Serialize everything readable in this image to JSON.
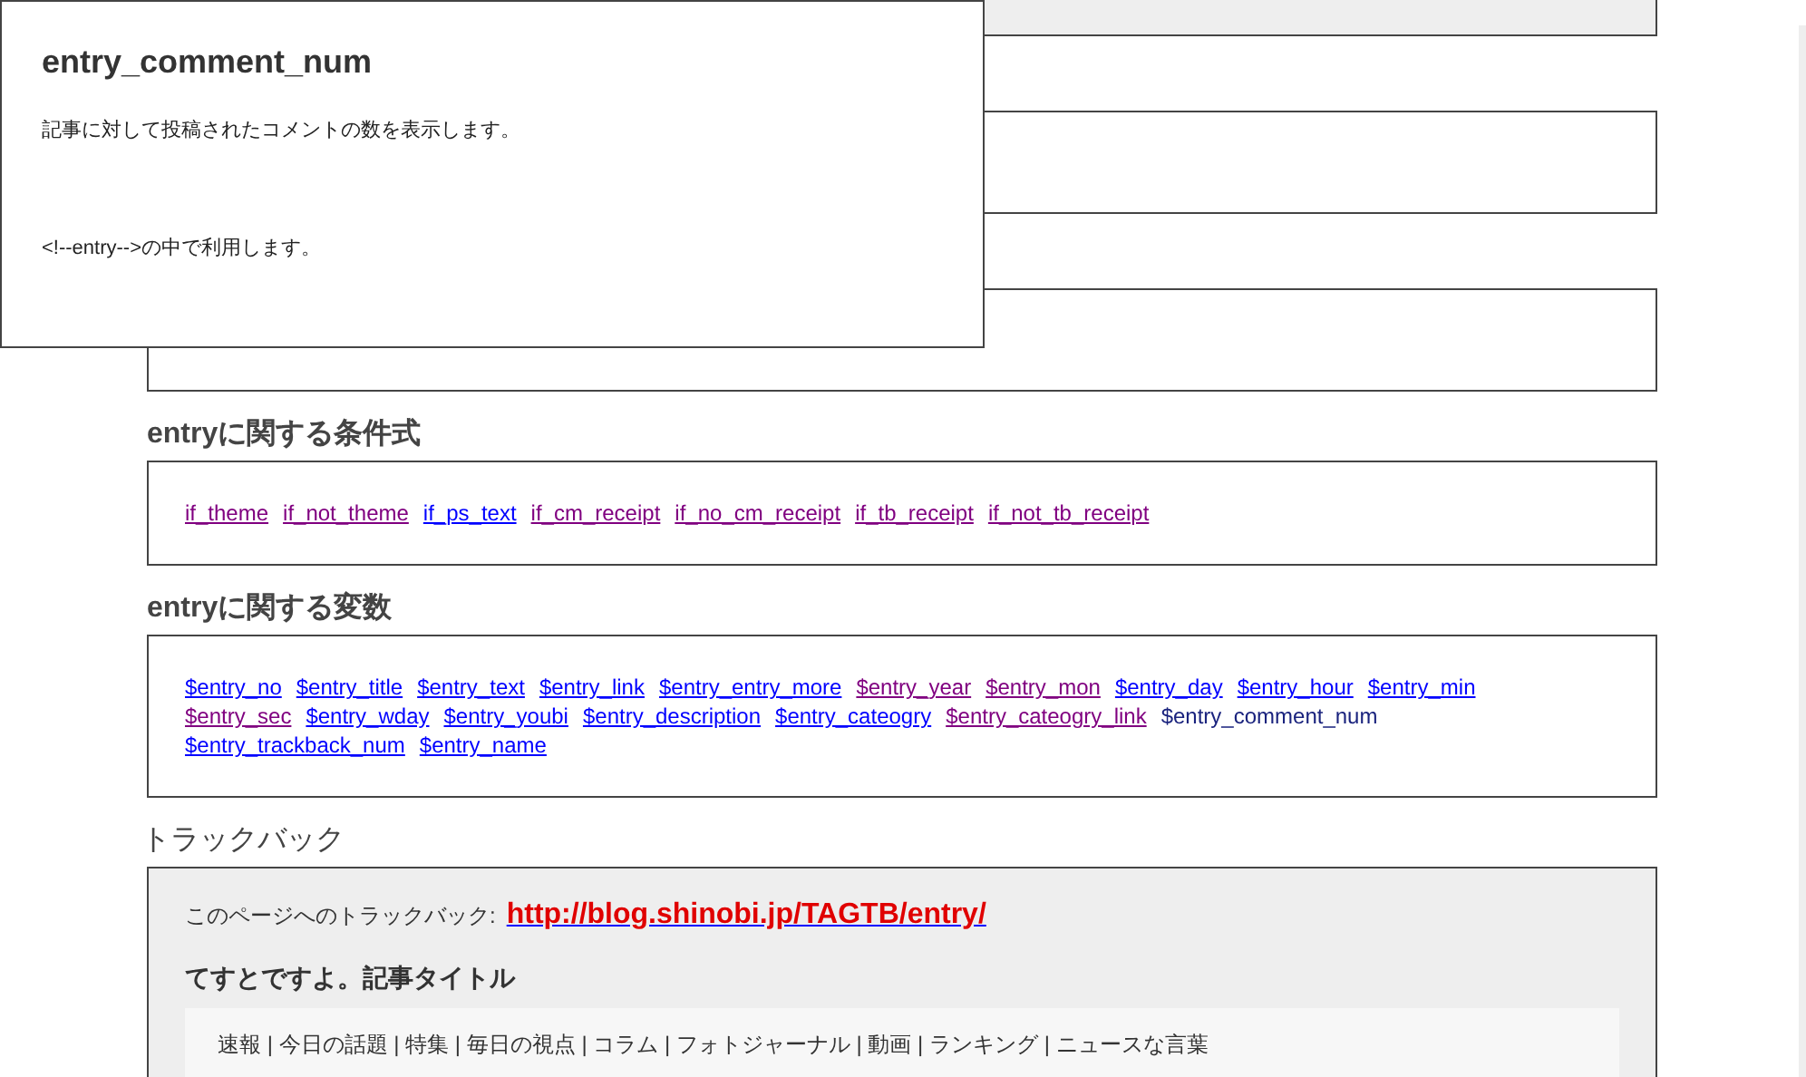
{
  "popup": {
    "title": "entry_comment_num",
    "description": "記事に対して投稿されたコメントの数を表示します。",
    "usage": "<!--entry-->の中で利用します。"
  },
  "sections": [
    {
      "heading": "entryに関する条件式",
      "items": [
        {
          "kind": "link",
          "text": "if_theme",
          "visited": true
        },
        {
          "kind": "link",
          "text": "if_not_theme",
          "visited": true
        },
        {
          "kind": "link",
          "text": "if_ps_text",
          "visited": false
        },
        {
          "kind": "link",
          "text": "if_cm_receipt",
          "visited": true
        },
        {
          "kind": "link",
          "text": "if_no_cm_receipt",
          "visited": true
        },
        {
          "kind": "link",
          "text": "if_tb_receipt",
          "visited": true
        },
        {
          "kind": "link",
          "text": "if_not_tb_receipt",
          "visited": true
        }
      ]
    },
    {
      "heading": "entryに関する変数",
      "items": [
        {
          "kind": "link",
          "text": "$entry_no",
          "visited": false
        },
        {
          "kind": "link",
          "text": "$entry_title",
          "visited": false
        },
        {
          "kind": "link",
          "text": "$entry_text",
          "visited": false
        },
        {
          "kind": "link",
          "text": "$entry_link",
          "visited": false
        },
        {
          "kind": "link",
          "text": "$entry_entry_more",
          "visited": false
        },
        {
          "kind": "link",
          "text": "$entry_year",
          "visited": true
        },
        {
          "kind": "link",
          "text": "$entry_mon",
          "visited": true
        },
        {
          "kind": "link",
          "text": "$entry_day",
          "visited": false
        },
        {
          "kind": "link",
          "text": "$entry_hour",
          "visited": false
        },
        {
          "kind": "link",
          "text": "$entry_min",
          "visited": false
        },
        {
          "kind": "link",
          "text": "$entry_sec",
          "visited": true
        },
        {
          "kind": "link",
          "text": "$entry_wday",
          "visited": false
        },
        {
          "kind": "link",
          "text": "$entry_youbi",
          "visited": false
        },
        {
          "kind": "link",
          "text": "$entry_description",
          "visited": false
        },
        {
          "kind": "link",
          "text": "$entry_cateogry",
          "visited": false
        },
        {
          "kind": "link",
          "text": "$entry_cateogry_link",
          "visited": true
        },
        {
          "kind": "current",
          "text": "$entry_comment_num"
        },
        {
          "kind": "link",
          "text": "$entry_trackback_num",
          "visited": false
        },
        {
          "kind": "link",
          "text": "$entry_name",
          "visited": false
        }
      ]
    }
  ],
  "trackback": {
    "heading": "トラックバック",
    "label": "このページへのトラックバック:",
    "url": "http://blog.shinobi.jp/TAGTB/entry/",
    "entry_title": "てすとですよ。記事タイトル",
    "nav": "速報 | 今日の話題 | 特集 | 毎日の視点 | コラム | フォトジャーナル | 動画 | ランキング | ニュースな言葉"
  }
}
